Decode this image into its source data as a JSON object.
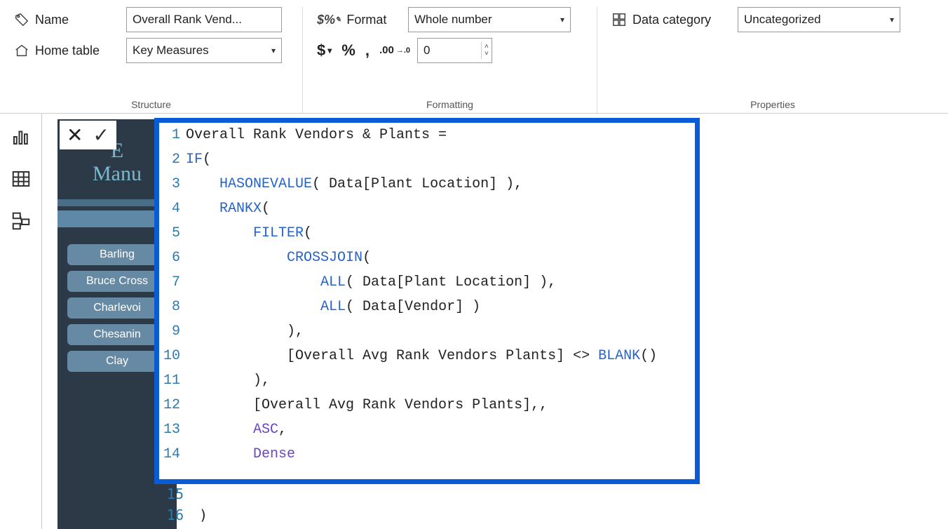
{
  "ribbon": {
    "structure": {
      "name_label": "Name",
      "name_value": "Overall Rank Vend...",
      "home_table_label": "Home table",
      "home_table_value": "Key Measures",
      "group": "Structure"
    },
    "formatting": {
      "format_label": "Format",
      "format_value": "Whole number",
      "decimal_value": "0",
      "group": "Formatting"
    },
    "properties": {
      "data_cat_label": "Data category",
      "data_cat_value": "Uncategorized",
      "group": "Properties"
    }
  },
  "report": {
    "logo_line1": "E",
    "logo_line2": "Manu",
    "pills": [
      "Barling",
      "Bruce Cross",
      "Charlevoi",
      "Chesanin",
      "Clay"
    ]
  },
  "code": {
    "extra_line15": "15",
    "extra_line16": "16",
    "extra_text16": ")",
    "lines": [
      {
        "n": 1,
        "segs": [
          [
            "plain",
            "Overall Rank Vendors & Plants = "
          ]
        ]
      },
      {
        "n": 2,
        "segs": [
          [
            "fn",
            "IF"
          ],
          [
            "plain",
            "("
          ]
        ]
      },
      {
        "n": 3,
        "segs": [
          [
            "plain",
            "    "
          ],
          [
            "fn",
            "HASONEVALUE"
          ],
          [
            "plain",
            "( Data[Plant Location] ),"
          ]
        ]
      },
      {
        "n": 4,
        "segs": [
          [
            "plain",
            "    "
          ],
          [
            "fn",
            "RANKX"
          ],
          [
            "plain",
            "("
          ]
        ]
      },
      {
        "n": 5,
        "segs": [
          [
            "plain",
            "        "
          ],
          [
            "fn",
            "FILTER"
          ],
          [
            "plain",
            "("
          ]
        ]
      },
      {
        "n": 6,
        "segs": [
          [
            "plain",
            "            "
          ],
          [
            "fn",
            "CROSSJOIN"
          ],
          [
            "plain",
            "("
          ]
        ]
      },
      {
        "n": 7,
        "segs": [
          [
            "plain",
            "                "
          ],
          [
            "fn",
            "ALL"
          ],
          [
            "plain",
            "( Data[Plant Location] ),"
          ]
        ]
      },
      {
        "n": 8,
        "segs": [
          [
            "plain",
            "                "
          ],
          [
            "fn",
            "ALL"
          ],
          [
            "plain",
            "( Data[Vendor] )"
          ]
        ]
      },
      {
        "n": 9,
        "segs": [
          [
            "plain",
            "            ),"
          ]
        ]
      },
      {
        "n": 10,
        "segs": [
          [
            "plain",
            "            [Overall Avg Rank Vendors Plants] <> "
          ],
          [
            "fn",
            "BLANK"
          ],
          [
            "plain",
            "()"
          ]
        ]
      },
      {
        "n": 11,
        "segs": [
          [
            "plain",
            "        ),"
          ]
        ]
      },
      {
        "n": 12,
        "segs": [
          [
            "plain",
            "        [Overall Avg Rank Vendors Plants],,"
          ]
        ]
      },
      {
        "n": 13,
        "segs": [
          [
            "plain",
            "        "
          ],
          [
            "key",
            "ASC"
          ],
          [
            "plain",
            ","
          ]
        ]
      },
      {
        "n": 14,
        "segs": [
          [
            "plain",
            "        "
          ],
          [
            "key",
            "Dense"
          ]
        ]
      }
    ]
  }
}
